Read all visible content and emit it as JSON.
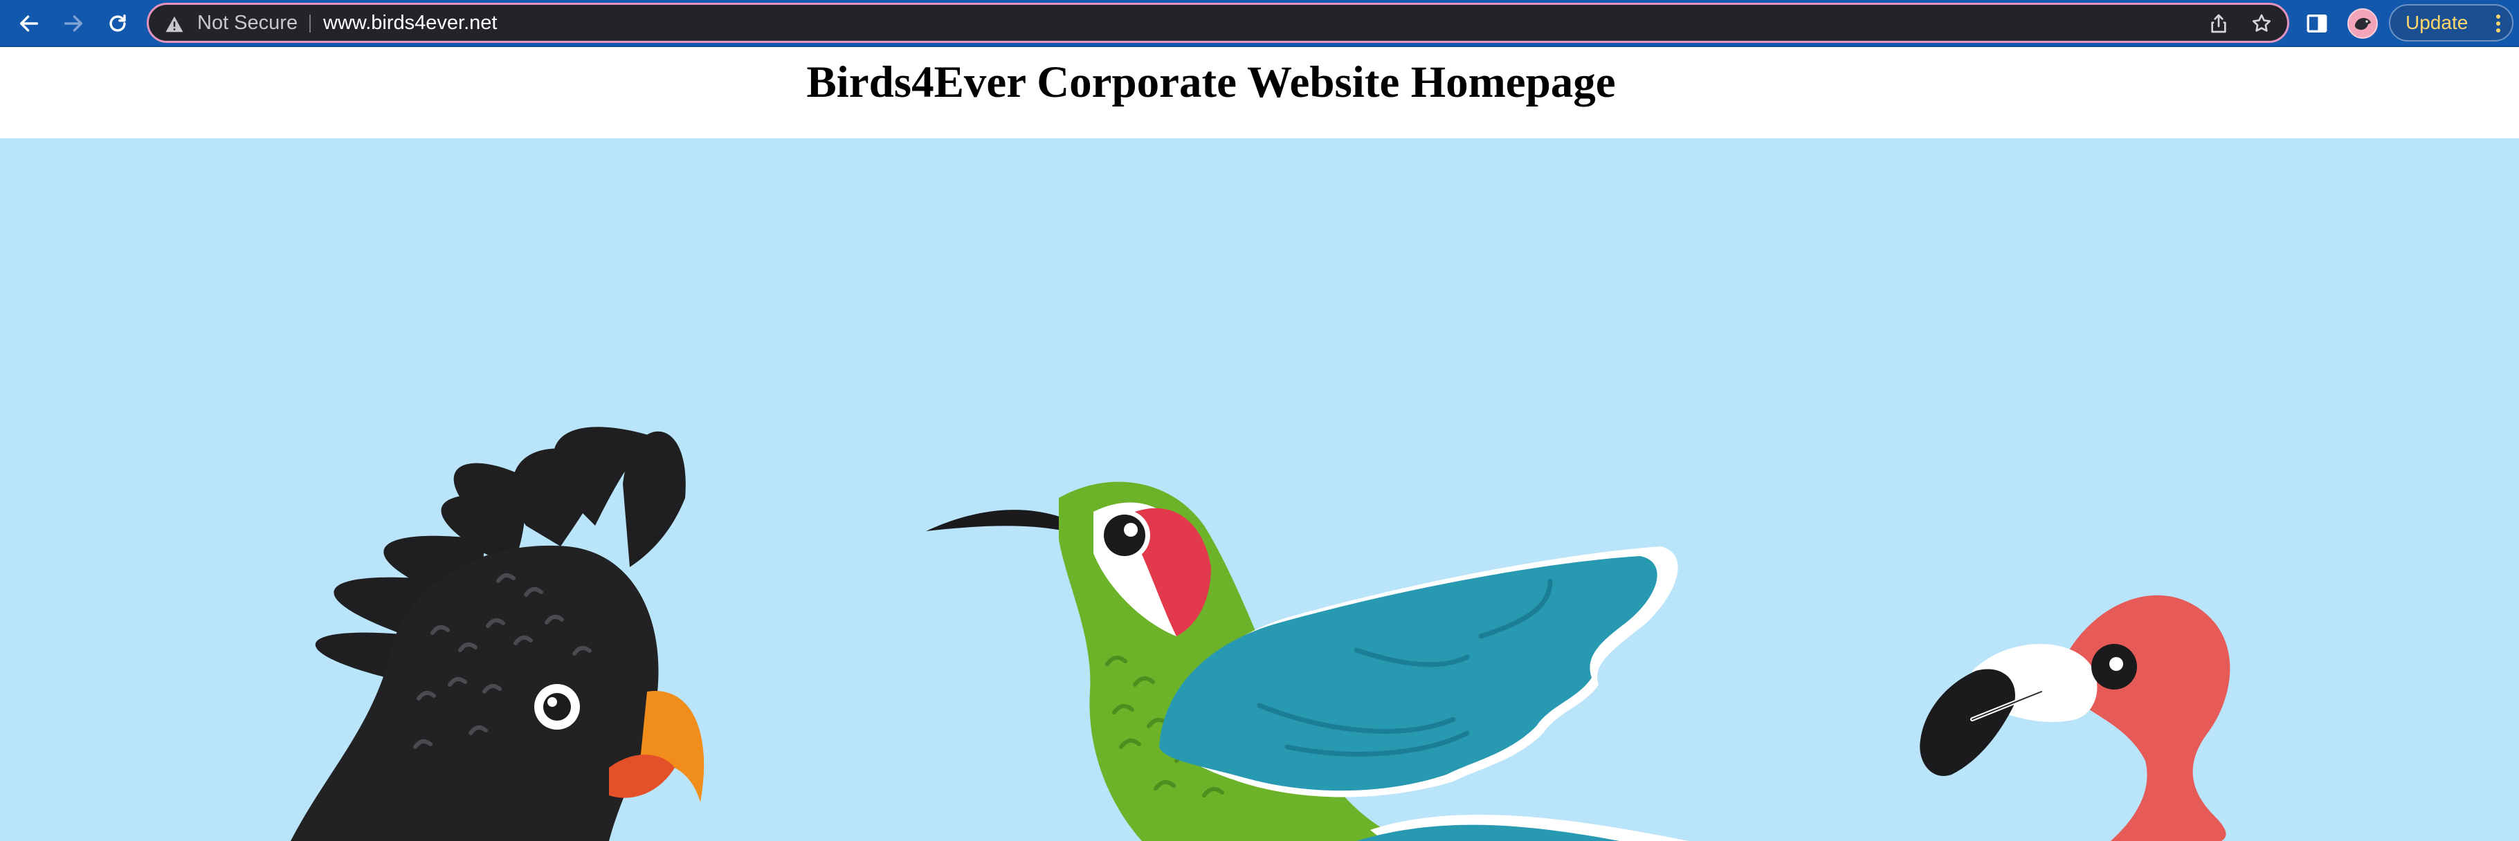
{
  "browser": {
    "security_label": "Not Secure",
    "url": "www.birds4ever.net",
    "update_label": "Update",
    "icons": {
      "back": "arrow-left-icon",
      "forward": "arrow-right-icon",
      "reload": "reload-icon",
      "warning": "warning-triangle-icon",
      "share": "share-icon",
      "bookmark": "star-icon",
      "side_panel": "side-panel-icon",
      "profile": "avatar",
      "menu": "kebab-menu-icon"
    },
    "colors": {
      "toolbar": "#1259ad",
      "omnibox": "#23232a",
      "omnibox_border": "#e493c0",
      "update_text": "#ffd769"
    }
  },
  "page": {
    "title": "Birds4Ever Corporate Website Homepage",
    "hero": {
      "background": "#b9e4fa",
      "illustrations": [
        "cockatoo",
        "hummingbird",
        "flamingo"
      ]
    }
  }
}
